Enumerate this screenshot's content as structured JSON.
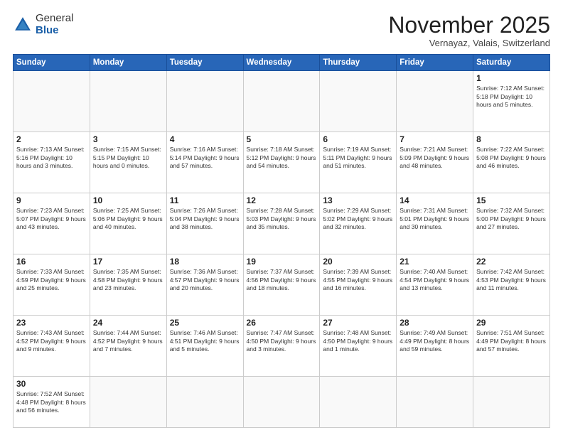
{
  "header": {
    "logo": {
      "general": "General",
      "blue": "Blue"
    },
    "title": "November 2025",
    "location": "Vernayaz, Valais, Switzerland"
  },
  "weekdays": [
    "Sunday",
    "Monday",
    "Tuesday",
    "Wednesday",
    "Thursday",
    "Friday",
    "Saturday"
  ],
  "weeks": [
    [
      {
        "day": "",
        "info": ""
      },
      {
        "day": "",
        "info": ""
      },
      {
        "day": "",
        "info": ""
      },
      {
        "day": "",
        "info": ""
      },
      {
        "day": "",
        "info": ""
      },
      {
        "day": "",
        "info": ""
      },
      {
        "day": "1",
        "info": "Sunrise: 7:12 AM\nSunset: 5:18 PM\nDaylight: 10 hours\nand 5 minutes."
      }
    ],
    [
      {
        "day": "2",
        "info": "Sunrise: 7:13 AM\nSunset: 5:16 PM\nDaylight: 10 hours\nand 3 minutes."
      },
      {
        "day": "3",
        "info": "Sunrise: 7:15 AM\nSunset: 5:15 PM\nDaylight: 10 hours\nand 0 minutes."
      },
      {
        "day": "4",
        "info": "Sunrise: 7:16 AM\nSunset: 5:14 PM\nDaylight: 9 hours\nand 57 minutes."
      },
      {
        "day": "5",
        "info": "Sunrise: 7:18 AM\nSunset: 5:12 PM\nDaylight: 9 hours\nand 54 minutes."
      },
      {
        "day": "6",
        "info": "Sunrise: 7:19 AM\nSunset: 5:11 PM\nDaylight: 9 hours\nand 51 minutes."
      },
      {
        "day": "7",
        "info": "Sunrise: 7:21 AM\nSunset: 5:09 PM\nDaylight: 9 hours\nand 48 minutes."
      },
      {
        "day": "8",
        "info": "Sunrise: 7:22 AM\nSunset: 5:08 PM\nDaylight: 9 hours\nand 46 minutes."
      }
    ],
    [
      {
        "day": "9",
        "info": "Sunrise: 7:23 AM\nSunset: 5:07 PM\nDaylight: 9 hours\nand 43 minutes."
      },
      {
        "day": "10",
        "info": "Sunrise: 7:25 AM\nSunset: 5:06 PM\nDaylight: 9 hours\nand 40 minutes."
      },
      {
        "day": "11",
        "info": "Sunrise: 7:26 AM\nSunset: 5:04 PM\nDaylight: 9 hours\nand 38 minutes."
      },
      {
        "day": "12",
        "info": "Sunrise: 7:28 AM\nSunset: 5:03 PM\nDaylight: 9 hours\nand 35 minutes."
      },
      {
        "day": "13",
        "info": "Sunrise: 7:29 AM\nSunset: 5:02 PM\nDaylight: 9 hours\nand 32 minutes."
      },
      {
        "day": "14",
        "info": "Sunrise: 7:31 AM\nSunset: 5:01 PM\nDaylight: 9 hours\nand 30 minutes."
      },
      {
        "day": "15",
        "info": "Sunrise: 7:32 AM\nSunset: 5:00 PM\nDaylight: 9 hours\nand 27 minutes."
      }
    ],
    [
      {
        "day": "16",
        "info": "Sunrise: 7:33 AM\nSunset: 4:59 PM\nDaylight: 9 hours\nand 25 minutes."
      },
      {
        "day": "17",
        "info": "Sunrise: 7:35 AM\nSunset: 4:58 PM\nDaylight: 9 hours\nand 23 minutes."
      },
      {
        "day": "18",
        "info": "Sunrise: 7:36 AM\nSunset: 4:57 PM\nDaylight: 9 hours\nand 20 minutes."
      },
      {
        "day": "19",
        "info": "Sunrise: 7:37 AM\nSunset: 4:56 PM\nDaylight: 9 hours\nand 18 minutes."
      },
      {
        "day": "20",
        "info": "Sunrise: 7:39 AM\nSunset: 4:55 PM\nDaylight: 9 hours\nand 16 minutes."
      },
      {
        "day": "21",
        "info": "Sunrise: 7:40 AM\nSunset: 4:54 PM\nDaylight: 9 hours\nand 13 minutes."
      },
      {
        "day": "22",
        "info": "Sunrise: 7:42 AM\nSunset: 4:53 PM\nDaylight: 9 hours\nand 11 minutes."
      }
    ],
    [
      {
        "day": "23",
        "info": "Sunrise: 7:43 AM\nSunset: 4:52 PM\nDaylight: 9 hours\nand 9 minutes."
      },
      {
        "day": "24",
        "info": "Sunrise: 7:44 AM\nSunset: 4:52 PM\nDaylight: 9 hours\nand 7 minutes."
      },
      {
        "day": "25",
        "info": "Sunrise: 7:46 AM\nSunset: 4:51 PM\nDaylight: 9 hours\nand 5 minutes."
      },
      {
        "day": "26",
        "info": "Sunrise: 7:47 AM\nSunset: 4:50 PM\nDaylight: 9 hours\nand 3 minutes."
      },
      {
        "day": "27",
        "info": "Sunrise: 7:48 AM\nSunset: 4:50 PM\nDaylight: 9 hours\nand 1 minute."
      },
      {
        "day": "28",
        "info": "Sunrise: 7:49 AM\nSunset: 4:49 PM\nDaylight: 8 hours\nand 59 minutes."
      },
      {
        "day": "29",
        "info": "Sunrise: 7:51 AM\nSunset: 4:49 PM\nDaylight: 8 hours\nand 57 minutes."
      }
    ],
    [
      {
        "day": "30",
        "info": "Sunrise: 7:52 AM\nSunset: 4:48 PM\nDaylight: 8 hours\nand 56 minutes."
      },
      {
        "day": "",
        "info": ""
      },
      {
        "day": "",
        "info": ""
      },
      {
        "day": "",
        "info": ""
      },
      {
        "day": "",
        "info": ""
      },
      {
        "day": "",
        "info": ""
      },
      {
        "day": "",
        "info": ""
      }
    ]
  ]
}
